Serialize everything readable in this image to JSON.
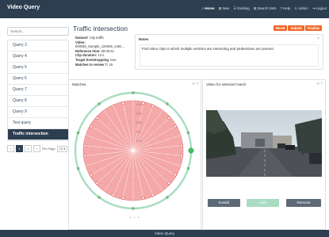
{
  "app": {
    "title": "Video Query"
  },
  "nav": {
    "items": [
      {
        "icon": "home-icon",
        "glyph": "⌂",
        "label": "Home",
        "active": true
      },
      {
        "icon": "plus-icon",
        "glyph": "⊞",
        "label": "New"
      },
      {
        "icon": "list-icon",
        "glyph": "☰",
        "label": "Existing"
      },
      {
        "icon": "search-icon",
        "glyph": "⊞",
        "label": "Search Sets"
      },
      {
        "icon": "help-icon",
        "glyph": "?",
        "label": "Help"
      },
      {
        "icon": "user-icon",
        "glyph": "♙",
        "label": "Admin"
      },
      {
        "icon": "logout-icon",
        "glyph": "⇥",
        "label": "Logout"
      }
    ]
  },
  "sidebar": {
    "search_placeholder": "Search...",
    "queries": [
      {
        "label": "Query 3"
      },
      {
        "label": "Query 4"
      },
      {
        "label": "Query 5"
      },
      {
        "label": "Query 6"
      },
      {
        "label": "Query 7"
      },
      {
        "label": "Query 8"
      },
      {
        "label": "Query 9"
      },
      {
        "label": "Test query"
      },
      {
        "label": "Traffic intersection",
        "active": true
      }
    ],
    "pager": {
      "prev": "‹",
      "page1": "1",
      "page2": "2",
      "next": "›",
      "per_page_label": "Per Page",
      "per_page_value": "10"
    }
  },
  "main": {
    "title": "Traffic intersection",
    "meta": {
      "dataset_label": "Dataset:",
      "dataset_value": "City traffic",
      "video_label": "Video:",
      "video_value": "00IN3S_Sample_120406_1481...",
      "ref_label": "Reference time:",
      "ref_value": "00:00:41",
      "clip_label": "Clip duration:",
      "clip_value": "13 s",
      "target_label": "Target bootstrapping:",
      "target_value": "true",
      "review_label": "Matches to review ?:",
      "review_value": "16"
    },
    "buttons": {
      "reset": "Reset",
      "submit": "Submit",
      "finalize": "Finalize"
    },
    "notes": {
      "label": "Notes",
      "close": "×",
      "text": "Find video clips in which multiple vehicles are interacting and pedestrians are present."
    }
  },
  "matches_panel": {
    "title": "Matches",
    "tools": "⟳ ?",
    "radial_labels": [
      "0.92",
      "0.82",
      "0.64",
      "0.4",
      "0.12"
    ],
    "pagination": "• • •"
  },
  "video_panel": {
    "title": "Video for selected match",
    "tools": "⟳ ?",
    "buttons": {
      "invalid": "Invalid",
      "valid": "Valid",
      "remove": "Remove"
    }
  },
  "footer": {
    "text": "Video Query"
  },
  "colors": {
    "nav": "#2c3e50",
    "accent": "#f0692a",
    "polar_fill": "#f4a8a8",
    "polar_ring": "#a9dcc0"
  }
}
